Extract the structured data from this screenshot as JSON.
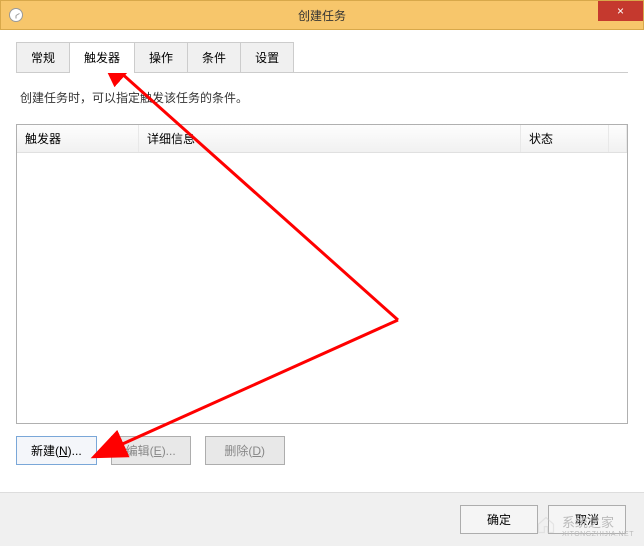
{
  "window": {
    "title": "创建任务",
    "close_symbol": "×"
  },
  "tabs": {
    "general": "常规",
    "triggers": "触发器",
    "actions": "操作",
    "conditions": "条件",
    "settings": "设置",
    "active": "triggers"
  },
  "description": "创建任务时，可以指定触发该任务的条件。",
  "table": {
    "headers": {
      "trigger": "触发器",
      "detail": "详细信息",
      "status": "状态"
    }
  },
  "buttons": {
    "new": {
      "prefix": "新建(",
      "hotkey": "N",
      "suffix": ")..."
    },
    "edit": {
      "prefix": "编辑(",
      "hotkey": "E",
      "suffix": ")..."
    },
    "delete": {
      "prefix": "删除(",
      "hotkey": "D",
      "suffix": ")"
    }
  },
  "dialog_buttons": {
    "ok": "确定",
    "cancel": "取消"
  },
  "watermark": {
    "text": "系统之家",
    "sub": "XITONGZHIJIA.NET"
  }
}
